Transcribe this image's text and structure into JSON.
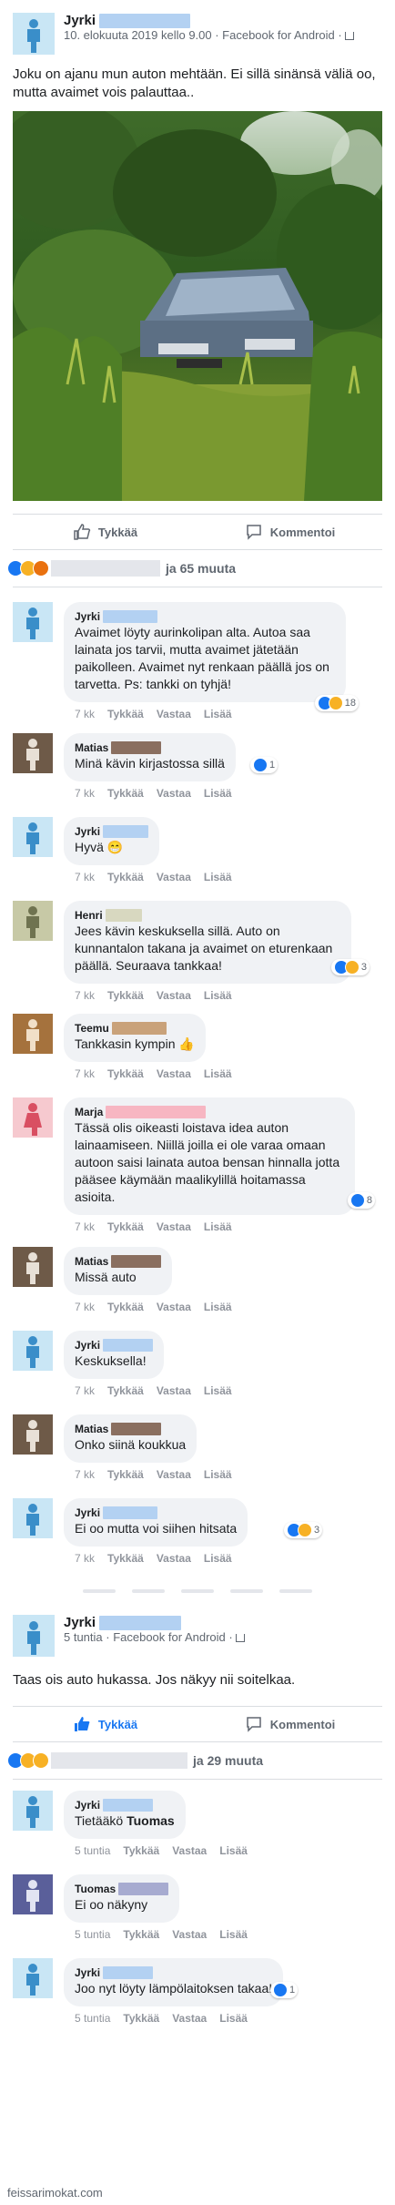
{
  "colors": {
    "like_blue": "#1877f2",
    "meta_gray": "#606770",
    "bubble": "#f0f2f5",
    "redact_blue": "#b3d1f2"
  },
  "post1": {
    "author": "Jyrki",
    "meta": "10. elokuuta 2019 kello 9.00 · Facebook for Android ·",
    "text": "Joku on ajanu mun auton mehtään. Ei sillä sinänsä väliä oo, mutta avaimet vois palauttaa..",
    "like_label": "Tykkää",
    "comment_label": "Kommentoi",
    "reactions_text": "ja 65 muuta"
  },
  "comments1": [
    {
      "author": "Jyrki",
      "text": "Avaimet löyty aurinkolipan alta. Autoa saa lainata jos tarvii, mutta avaimet jätetään paikolleen. Avaimet nyt renkaan päällä jos on tarvetta. Ps: tankki on tyhjä!",
      "time": "7 kk",
      "reacts": "18"
    },
    {
      "author": "Matias",
      "text": "Minä kävin kirjastossa sillä",
      "time": "7 kk",
      "reacts": "1"
    },
    {
      "author": "Jyrki",
      "text": "Hyvä 😁",
      "time": "7 kk",
      "reacts": ""
    },
    {
      "author": "Henri",
      "text": "Jees kävin keskuksella sillä. Auto on kunnantalon takana ja avaimet on eturenkaan päällä. Seuraava tankkaa!",
      "time": "7 kk",
      "reacts": "3"
    },
    {
      "author": "Teemu",
      "text": "Tankkasin kympin 👍",
      "time": "7 kk",
      "reacts": ""
    },
    {
      "author": "Marja",
      "text": "Tässä olis oikeasti loistava idea auton lainaamiseen. Niillä joilla ei ole varaa omaan autoon saisi lainata autoa bensan hinnalla jotta pääsee käymään maalikylillä hoitamassa asioita.",
      "time": "7 kk",
      "reacts": "8"
    },
    {
      "author": "Matias",
      "text": "Missä auto",
      "time": "7 kk",
      "reacts": ""
    },
    {
      "author": "Jyrki",
      "text": "Keskuksella!",
      "time": "7 kk",
      "reacts": ""
    },
    {
      "author": "Matias",
      "text": "Onko siinä koukkua",
      "time": "7 kk",
      "reacts": ""
    },
    {
      "author": "Jyrki",
      "text": "Ei oo mutta voi siihen hitsata",
      "time": "7 kk",
      "reacts": "3"
    }
  ],
  "comment_actions": {
    "like": "Tykkää",
    "reply": "Vastaa",
    "more": "Lisää"
  },
  "post2": {
    "author": "Jyrki",
    "meta": "5 tuntia · Facebook for Android ·",
    "text": "Taas ois auto hukassa. Jos näkyy nii soitelkaa.",
    "like_label": "Tykkää",
    "comment_label": "Kommentoi",
    "reactions_text": "ja 29 muuta"
  },
  "comments2": [
    {
      "author": "Jyrki",
      "text_prefix": "Tietääkö ",
      "text_bold": "Tuomas",
      "time": "5 tuntia"
    },
    {
      "author": "Tuomas",
      "text": "Ei oo näkyny",
      "time": "5 tuntia"
    },
    {
      "author": "Jyrki",
      "text": "Joo nyt löyty lämpölaitoksen takaa!",
      "time": "5 tuntia",
      "reacts": "1"
    }
  ],
  "watermark": "feissarimokat.com"
}
